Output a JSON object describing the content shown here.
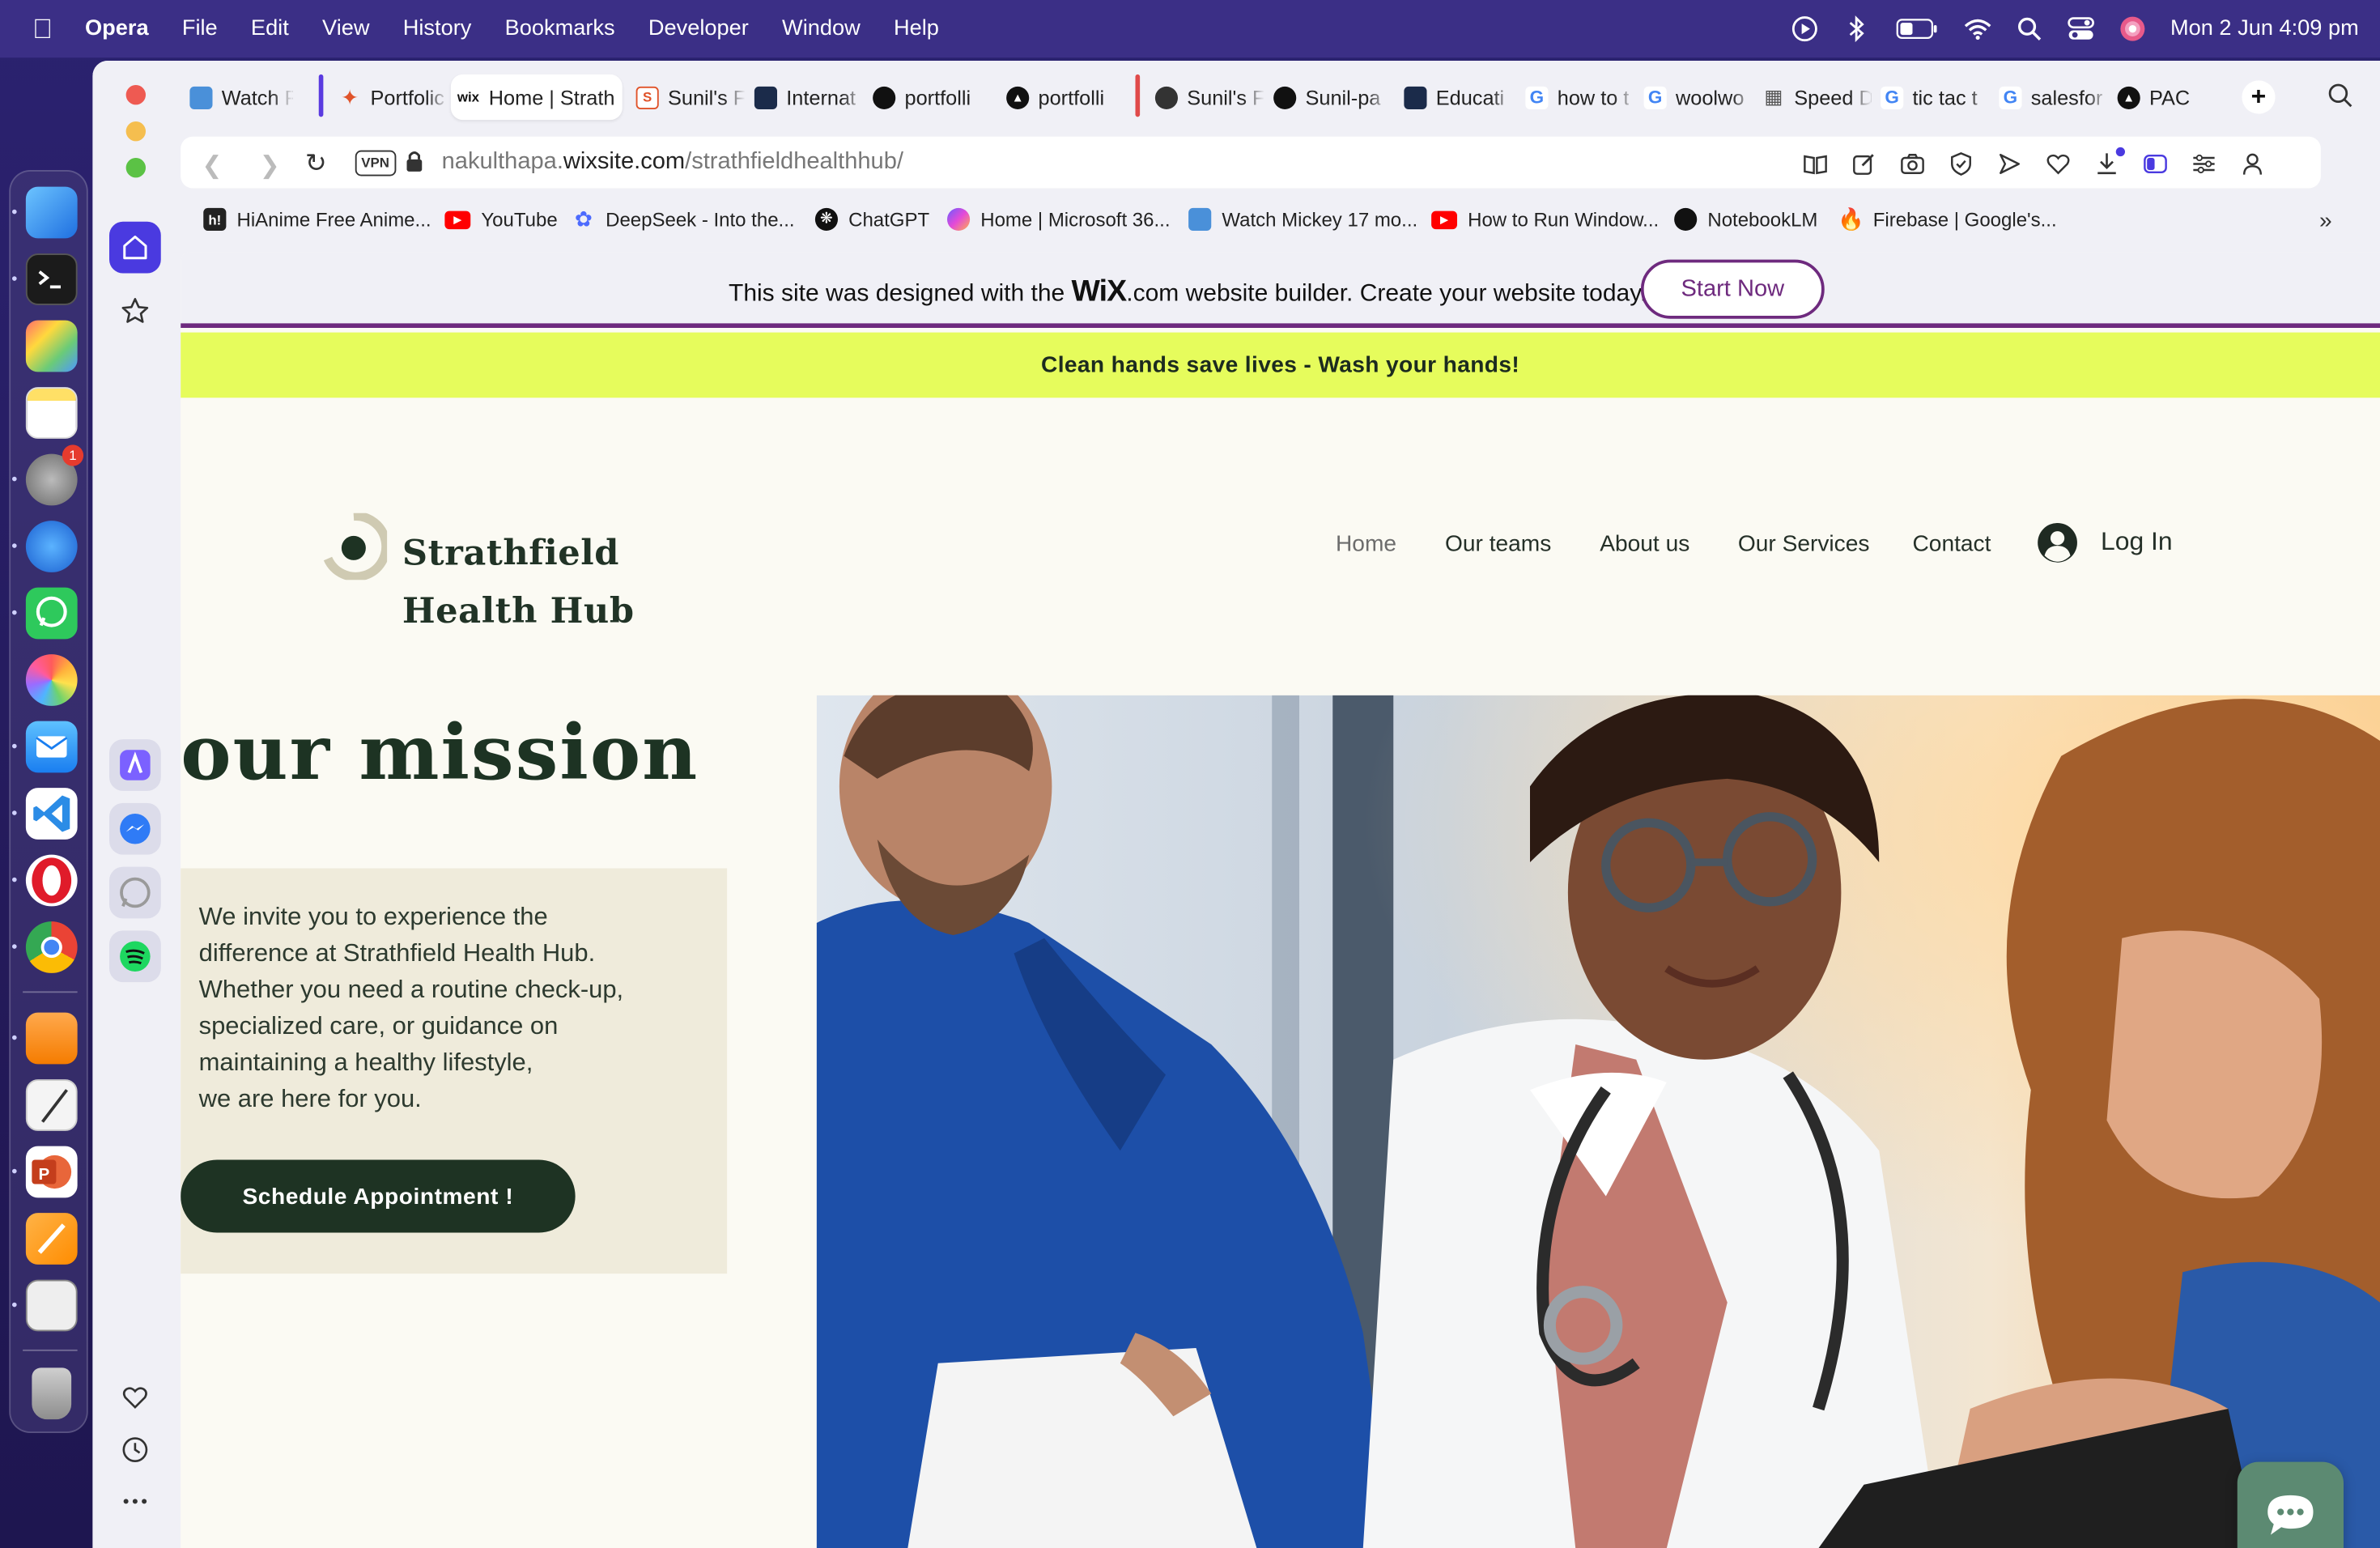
{
  "menubar": {
    "app_name": "Opera",
    "items": [
      "File",
      "Edit",
      "View",
      "History",
      "Bookmarks",
      "Developer",
      "Window",
      "Help"
    ],
    "datetime": "Mon 2 Jun  4:09 pm"
  },
  "tabs": [
    {
      "label": "Watch F",
      "favicon": "film-icon",
      "color": "#4a90d9"
    },
    {
      "label": "Portfolic",
      "favicon": "slash-icon",
      "color": "#e0532a"
    },
    {
      "label": "Home | Strath",
      "favicon": "wix-icon",
      "color": "#111111",
      "active": true
    },
    {
      "label": "Sunil's F",
      "favicon": "swirl-icon",
      "color": "#e0532a"
    },
    {
      "label": "Internat",
      "favicon": "award-icon",
      "color": "#1b2b4a"
    },
    {
      "label": "portfolli",
      "favicon": "github-icon",
      "color": "#111111"
    },
    {
      "label": "portfolli",
      "favicon": "triangle-icon",
      "color": "#111111"
    },
    {
      "label": "Sunil's F",
      "favicon": "globe-icon",
      "color": "#333333"
    },
    {
      "label": "Sunil-pa",
      "favicon": "github-icon",
      "color": "#111111"
    },
    {
      "label": "Educati",
      "favicon": "edu-icon",
      "color": "#1b2b4a"
    },
    {
      "label": "how to t",
      "favicon": "google-icon",
      "color": "#4285f4"
    },
    {
      "label": "woolwo",
      "favicon": "google-icon",
      "color": "#4285f4"
    },
    {
      "label": "Speed D",
      "favicon": "grid-icon",
      "color": "#555555"
    },
    {
      "label": "tic tac t",
      "favicon": "google-icon",
      "color": "#4285f4"
    },
    {
      "label": "salesfor",
      "favicon": "google-icon",
      "color": "#4285f4"
    },
    {
      "label": "PAC",
      "favicon": "triangle-icon",
      "color": "#111111"
    }
  ],
  "address": {
    "vpn_label": "VPN",
    "url_prefix": "nakulthapa.",
    "url_domain": "wixsite.com",
    "url_path": "/strathfieldhealthhub/"
  },
  "bookmarks": [
    {
      "label": "HiAnime Free Anime...",
      "favicon": "hianime-icon",
      "color": "#222222"
    },
    {
      "label": "YouTube",
      "favicon": "youtube-icon",
      "color": "#ff0000"
    },
    {
      "label": "DeepSeek - Into the...",
      "favicon": "deepseek-icon",
      "color": "#4d6bfe"
    },
    {
      "label": "ChatGPT",
      "favicon": "chatgpt-icon",
      "color": "#111111"
    },
    {
      "label": "Home | Microsoft 36...",
      "favicon": "microsoft365-icon",
      "color": "#c04ad8"
    },
    {
      "label": "Watch Mickey 17 mo...",
      "favicon": "film-icon",
      "color": "#4a90d9"
    },
    {
      "label": "How to Run Window...",
      "favicon": "youtube-icon",
      "color": "#ff0000"
    },
    {
      "label": "NotebookLM",
      "favicon": "notebooklm-icon",
      "color": "#111111"
    },
    {
      "label": "Firebase | Google's...",
      "favicon": "firebase-icon",
      "color": "#f57c00"
    }
  ],
  "wix_banner": {
    "text_before": "This site was designed with the ",
    "wix_logo": "WiX",
    "text_after": ".com website builder. Create your website today.",
    "button": "Start Now"
  },
  "notice": "Clean hands save lives - Wash your hands!",
  "site": {
    "logo_line1": "Strathfield",
    "logo_line2": "Health Hub",
    "nav": [
      "Home",
      "Our teams",
      "About us",
      "Our Services",
      "Contact"
    ],
    "login": "Log In",
    "mission_heading": "our mission",
    "intro_lines": [
      "We invite you to experience the",
      "difference at Strathfield Health Hub.",
      "Whether you need a routine check-up,",
      "specialized care, or guidance on",
      "maintaining a healthy lifestyle,",
      "we are here for you."
    ],
    "cta": "Schedule Appointment !"
  },
  "colors": {
    "wix_accent": "#6e2a7e",
    "notice_bg": "#e6fc5c",
    "brand_dark": "#1e3323",
    "page_bg": "#fbfaf3",
    "intro_bg": "#efebdb",
    "chat_bg": "#5c8a72"
  }
}
